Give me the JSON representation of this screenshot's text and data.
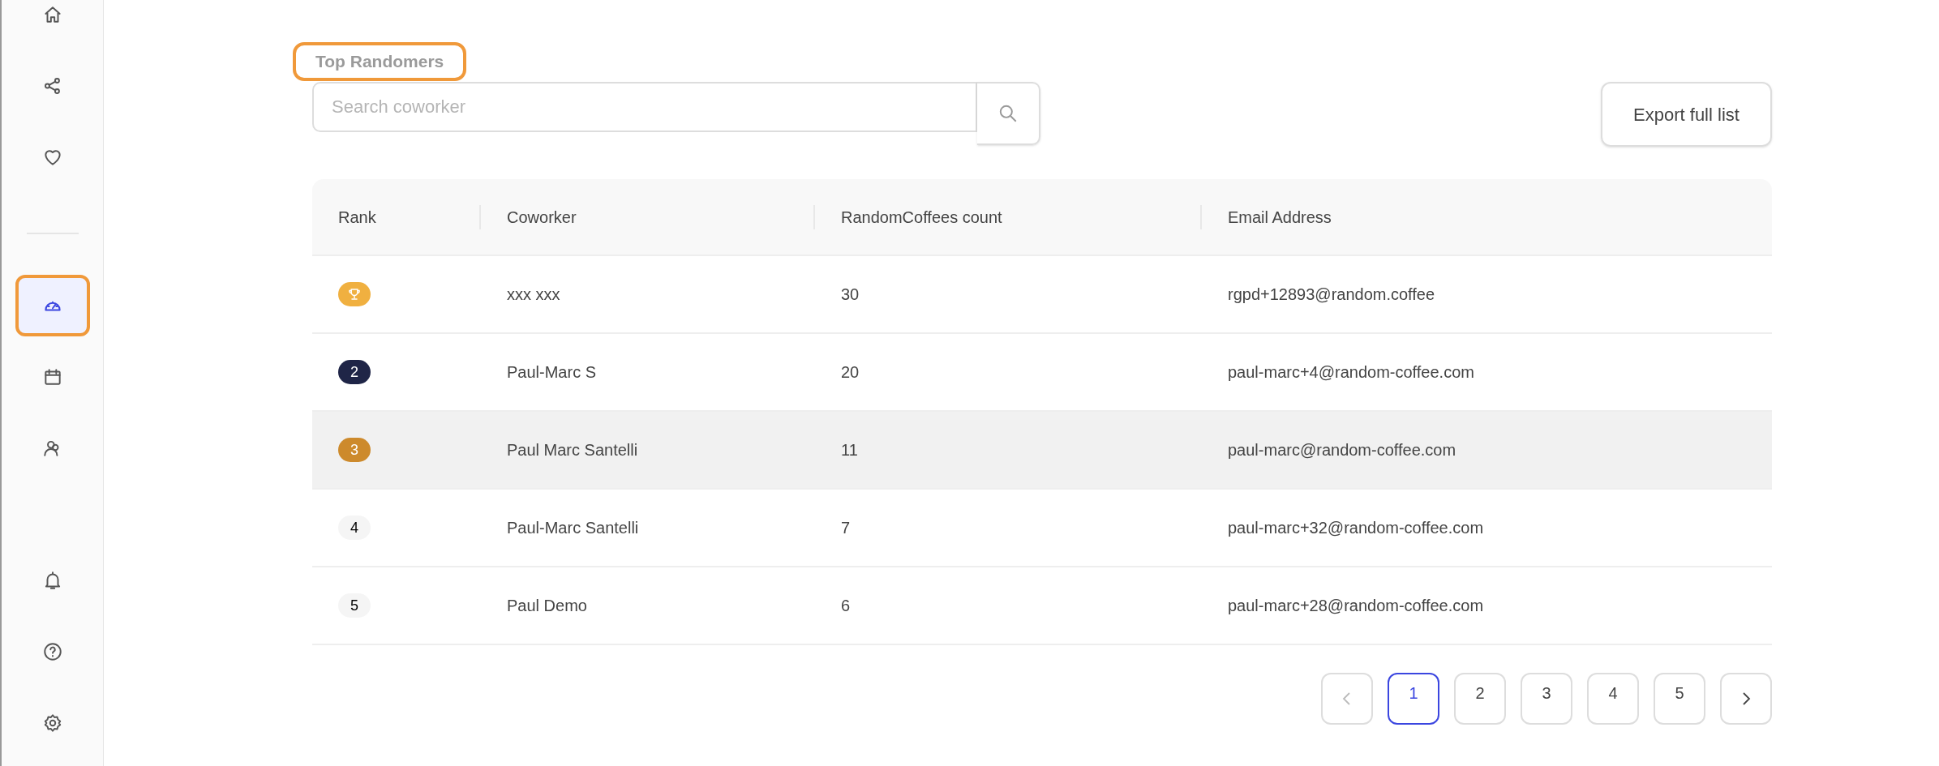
{
  "sidebar": {
    "items": [
      {
        "selected": false,
        "highlighted": false
      },
      {
        "selected": false,
        "highlighted": false
      },
      {
        "selected": false,
        "highlighted": false
      },
      {
        "selected": true,
        "highlighted": true
      },
      {
        "selected": false,
        "highlighted": false
      },
      {
        "selected": false,
        "highlighted": false
      },
      {
        "selected": false,
        "highlighted": false
      },
      {
        "selected": false,
        "highlighted": false
      },
      {
        "selected": false,
        "highlighted": false
      }
    ]
  },
  "title": {
    "text": "Top Randomers",
    "highlighted": true
  },
  "search": {
    "placeholder": "Search coworker"
  },
  "export_button": "Export full list",
  "table": {
    "columns": [
      "Rank",
      "Coworker",
      "RandomCoffees count",
      "Email Address"
    ],
    "rows": [
      {
        "rank": {
          "kind": "trophy",
          "color": "#f0b040"
        },
        "coworker": "xxx xxx",
        "count": "30",
        "email": "rgpd+12893@random.coffee",
        "highlighted": false
      },
      {
        "rank": {
          "kind": "number",
          "text": "2",
          "color": "#1f2547"
        },
        "coworker": "Paul-Marc S",
        "count": "20",
        "email": "paul-marc+4@random-coffee.com",
        "highlighted": false
      },
      {
        "rank": {
          "kind": "number",
          "text": "3",
          "color": "#cd8a2c"
        },
        "coworker": "Paul Marc Santelli",
        "count": "11",
        "email": "paul-marc@random-coffee.com",
        "highlighted": true
      },
      {
        "rank": {
          "kind": "number",
          "text": "4",
          "color": "#f5f5f5"
        },
        "coworker": "Paul-Marc Santelli",
        "count": "7",
        "email": "paul-marc+32@random-coffee.com",
        "highlighted": false
      },
      {
        "rank": {
          "kind": "number",
          "text": "5",
          "color": "#f5f5f5"
        },
        "coworker": "Paul Demo",
        "count": "6",
        "email": "paul-marc+28@random-coffee.com",
        "highlighted": false
      }
    ]
  },
  "pagination": {
    "previous": {
      "disabled": true
    },
    "pages": [
      {
        "label": "1",
        "selected": true
      },
      {
        "label": "2",
        "selected": false
      },
      {
        "label": "3",
        "selected": false
      },
      {
        "label": "4",
        "selected": false
      },
      {
        "label": "5",
        "selected": false
      }
    ],
    "next": {
      "disabled": false
    }
  }
}
